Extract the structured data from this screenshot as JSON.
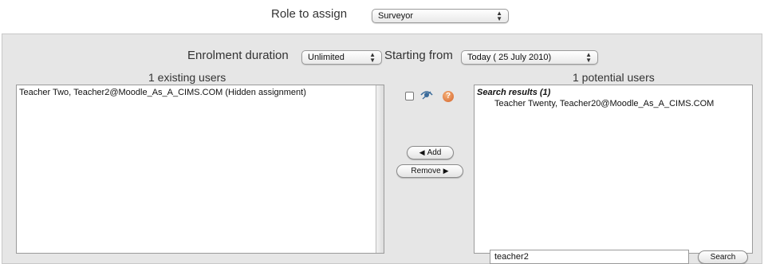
{
  "role": {
    "label": "Role to assign",
    "selected": "Surveyor"
  },
  "enrolment": {
    "duration_label": "Enrolment duration",
    "duration_selected": "Unlimited",
    "starting_label": "Starting from",
    "starting_selected": "Today ( 25 July 2010)"
  },
  "existing": {
    "header": "1 existing users",
    "items": [
      "Teacher Two, Teacher2@Moodle_As_A_CIMS.COM (Hidden assignment)"
    ]
  },
  "potential": {
    "header": "1 potential users",
    "group_label": "Search results (1)",
    "items": [
      "Teacher Twenty, Teacher20@Moodle_As_A_CIMS.COM"
    ]
  },
  "buttons": {
    "add": "Add",
    "remove": "Remove"
  },
  "search": {
    "value": "teacher2",
    "button": "Search"
  },
  "icons": {
    "hidden": "eye-icon",
    "help": "help-icon",
    "add_arrow": "left-arrow-icon",
    "remove_arrow": "right-arrow-icon",
    "select_arrows": "updown-arrows-icon"
  }
}
